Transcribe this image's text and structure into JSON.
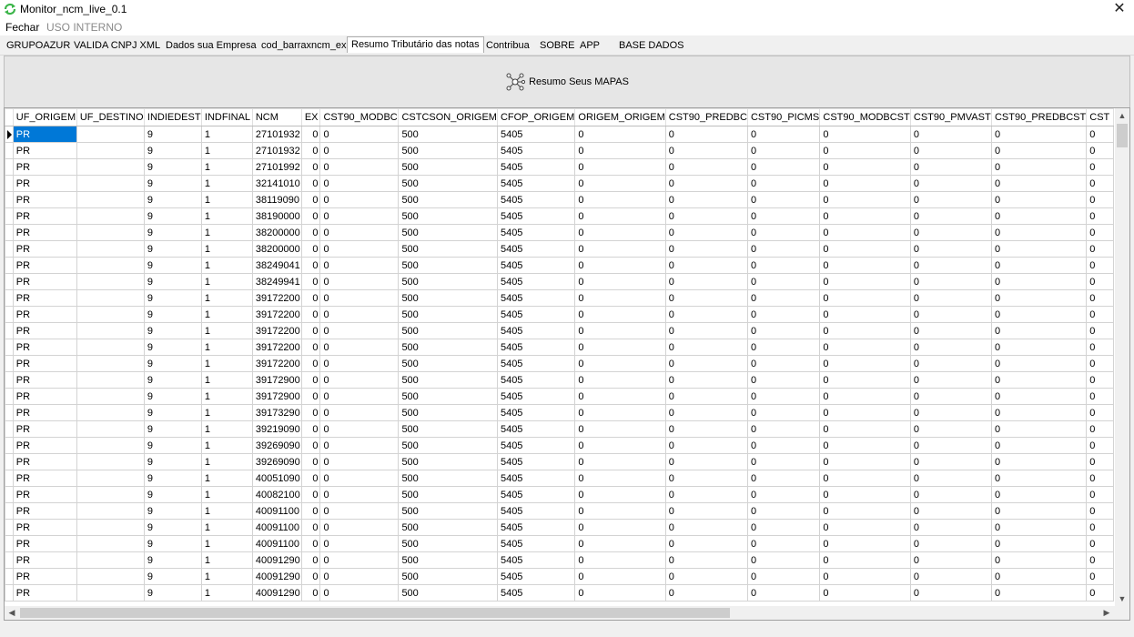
{
  "window": {
    "title": "Monitor_ncm_live_0.1",
    "close_label": "✕"
  },
  "menu": {
    "items": [
      "Fechar",
      "USO INTERNO"
    ]
  },
  "tabs": [
    "GRUPOAZUR",
    "VALIDA CNPJ XML",
    "Dados sua Empresa",
    "cod_barraxncm_ex",
    "Resumo Tributário das notas",
    "Contribua",
    "SOBRE",
    "APP",
    "BASE DADOS"
  ],
  "active_tab": "Resumo Tributário das notas",
  "panel": {
    "button_label": "Resumo Seus MAPAS",
    "icon": "network-icon"
  },
  "grid": {
    "columns": [
      "UF_ORIGEM",
      "UF_DESTINO",
      "INDIEDEST",
      "INDFINAL",
      "NCM",
      "EX",
      "CST90_MODBC",
      "CSTCSON_ORIGEM",
      "CFOP_ORIGEM",
      "ORIGEM_ORIGEM",
      "CST90_PREDBC",
      "CST90_PICMS",
      "CST90_MODBCST",
      "CST90_PMVAST",
      "CST90_PREDBCST",
      "CST"
    ],
    "rows": [
      [
        "PR",
        "",
        "9",
        "1",
        "27101932",
        "0",
        "0",
        "500",
        "5405",
        "0",
        "0",
        "0",
        "0",
        "0",
        "0",
        "0"
      ],
      [
        "PR",
        "",
        "9",
        "1",
        "27101932",
        "0",
        "0",
        "500",
        "5405",
        "0",
        "0",
        "0",
        "0",
        "0",
        "0",
        "0"
      ],
      [
        "PR",
        "",
        "9",
        "1",
        "27101992",
        "0",
        "0",
        "500",
        "5405",
        "0",
        "0",
        "0",
        "0",
        "0",
        "0",
        "0"
      ],
      [
        "PR",
        "",
        "9",
        "1",
        "32141010",
        "0",
        "0",
        "500",
        "5405",
        "0",
        "0",
        "0",
        "0",
        "0",
        "0",
        "0"
      ],
      [
        "PR",
        "",
        "9",
        "1",
        "38119090",
        "0",
        "0",
        "500",
        "5405",
        "0",
        "0",
        "0",
        "0",
        "0",
        "0",
        "0"
      ],
      [
        "PR",
        "",
        "9",
        "1",
        "38190000",
        "0",
        "0",
        "500",
        "5405",
        "0",
        "0",
        "0",
        "0",
        "0",
        "0",
        "0"
      ],
      [
        "PR",
        "",
        "9",
        "1",
        "38200000",
        "0",
        "0",
        "500",
        "5405",
        "0",
        "0",
        "0",
        "0",
        "0",
        "0",
        "0"
      ],
      [
        "PR",
        "",
        "9",
        "1",
        "38200000",
        "0",
        "0",
        "500",
        "5405",
        "0",
        "0",
        "0",
        "0",
        "0",
        "0",
        "0"
      ],
      [
        "PR",
        "",
        "9",
        "1",
        "38249041",
        "0",
        "0",
        "500",
        "5405",
        "0",
        "0",
        "0",
        "0",
        "0",
        "0",
        "0"
      ],
      [
        "PR",
        "",
        "9",
        "1",
        "38249941",
        "0",
        "0",
        "500",
        "5405",
        "0",
        "0",
        "0",
        "0",
        "0",
        "0",
        "0"
      ],
      [
        "PR",
        "",
        "9",
        "1",
        "39172200",
        "0",
        "0",
        "500",
        "5405",
        "0",
        "0",
        "0",
        "0",
        "0",
        "0",
        "0"
      ],
      [
        "PR",
        "",
        "9",
        "1",
        "39172200",
        "0",
        "0",
        "500",
        "5405",
        "0",
        "0",
        "0",
        "0",
        "0",
        "0",
        "0"
      ],
      [
        "PR",
        "",
        "9",
        "1",
        "39172200",
        "0",
        "0",
        "500",
        "5405",
        "0",
        "0",
        "0",
        "0",
        "0",
        "0",
        "0"
      ],
      [
        "PR",
        "",
        "9",
        "1",
        "39172200",
        "0",
        "0",
        "500",
        "5405",
        "0",
        "0",
        "0",
        "0",
        "0",
        "0",
        "0"
      ],
      [
        "PR",
        "",
        "9",
        "1",
        "39172200",
        "0",
        "0",
        "500",
        "5405",
        "0",
        "0",
        "0",
        "0",
        "0",
        "0",
        "0"
      ],
      [
        "PR",
        "",
        "9",
        "1",
        "39172900",
        "0",
        "0",
        "500",
        "5405",
        "0",
        "0",
        "0",
        "0",
        "0",
        "0",
        "0"
      ],
      [
        "PR",
        "",
        "9",
        "1",
        "39172900",
        "0",
        "0",
        "500",
        "5405",
        "0",
        "0",
        "0",
        "0",
        "0",
        "0",
        "0"
      ],
      [
        "PR",
        "",
        "9",
        "1",
        "39173290",
        "0",
        "0",
        "500",
        "5405",
        "0",
        "0",
        "0",
        "0",
        "0",
        "0",
        "0"
      ],
      [
        "PR",
        "",
        "9",
        "1",
        "39219090",
        "0",
        "0",
        "500",
        "5405",
        "0",
        "0",
        "0",
        "0",
        "0",
        "0",
        "0"
      ],
      [
        "PR",
        "",
        "9",
        "1",
        "39269090",
        "0",
        "0",
        "500",
        "5405",
        "0",
        "0",
        "0",
        "0",
        "0",
        "0",
        "0"
      ],
      [
        "PR",
        "",
        "9",
        "1",
        "39269090",
        "0",
        "0",
        "500",
        "5405",
        "0",
        "0",
        "0",
        "0",
        "0",
        "0",
        "0"
      ],
      [
        "PR",
        "",
        "9",
        "1",
        "40051090",
        "0",
        "0",
        "500",
        "5405",
        "0",
        "0",
        "0",
        "0",
        "0",
        "0",
        "0"
      ],
      [
        "PR",
        "",
        "9",
        "1",
        "40082100",
        "0",
        "0",
        "500",
        "5405",
        "0",
        "0",
        "0",
        "0",
        "0",
        "0",
        "0"
      ],
      [
        "PR",
        "",
        "9",
        "1",
        "40091100",
        "0",
        "0",
        "500",
        "5405",
        "0",
        "0",
        "0",
        "0",
        "0",
        "0",
        "0"
      ],
      [
        "PR",
        "",
        "9",
        "1",
        "40091100",
        "0",
        "0",
        "500",
        "5405",
        "0",
        "0",
        "0",
        "0",
        "0",
        "0",
        "0"
      ],
      [
        "PR",
        "",
        "9",
        "1",
        "40091100",
        "0",
        "0",
        "500",
        "5405",
        "0",
        "0",
        "0",
        "0",
        "0",
        "0",
        "0"
      ],
      [
        "PR",
        "",
        "9",
        "1",
        "40091290",
        "0",
        "0",
        "500",
        "5405",
        "0",
        "0",
        "0",
        "0",
        "0",
        "0",
        "0"
      ],
      [
        "PR",
        "",
        "9",
        "1",
        "40091290",
        "0",
        "0",
        "500",
        "5405",
        "0",
        "0",
        "0",
        "0",
        "0",
        "0",
        "0"
      ],
      [
        "PR",
        "",
        "9",
        "1",
        "40091290",
        "0",
        "0",
        "500",
        "5405",
        "0",
        "0",
        "0",
        "0",
        "0",
        "0",
        "0"
      ]
    ],
    "selected_row": 0,
    "selected_col": 0,
    "selection_color": "#0078d7"
  },
  "colors": {
    "window_bg": "#f0f0f0",
    "grid_bg": "#ffffff",
    "selection": "#0078d7",
    "app_icon": "#3cb54a"
  }
}
